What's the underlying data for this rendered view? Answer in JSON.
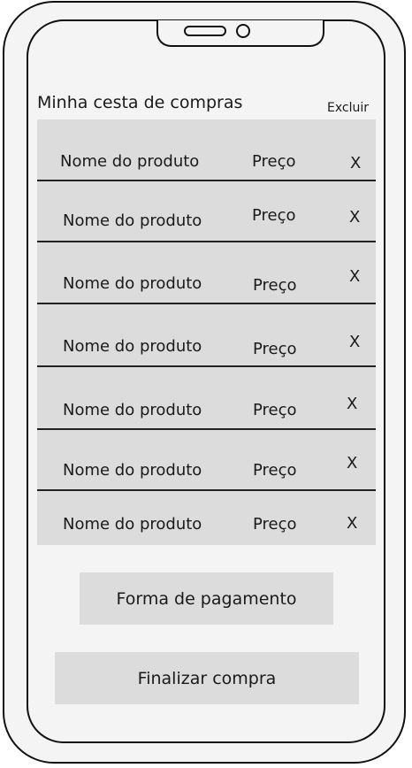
{
  "header": {
    "title": "Minha cesta de compras",
    "delete_label": "Excluir"
  },
  "cart": {
    "items": [
      {
        "name": "Nome do produto",
        "price": "Preço",
        "remove": "X"
      },
      {
        "name": "Nome do produto",
        "price": "Preço",
        "remove": "X"
      },
      {
        "name": "Nome do produto",
        "price": "Preço",
        "remove": "X"
      },
      {
        "name": "Nome do produto",
        "price": "Preço",
        "remove": "X"
      },
      {
        "name": "Nome do produto",
        "price": "Preço",
        "remove": "X"
      },
      {
        "name": "Nome do produto",
        "price": "Preço",
        "remove": "X"
      },
      {
        "name": "Nome do produto",
        "price": "Preço",
        "remove": "X"
      }
    ]
  },
  "actions": {
    "payment_label": "Forma de pagamento",
    "finish_label": "Finalizar compra"
  },
  "colors": {
    "background": "#f4f4f4",
    "panel": "#dcdcdc",
    "outline": "#111111"
  }
}
